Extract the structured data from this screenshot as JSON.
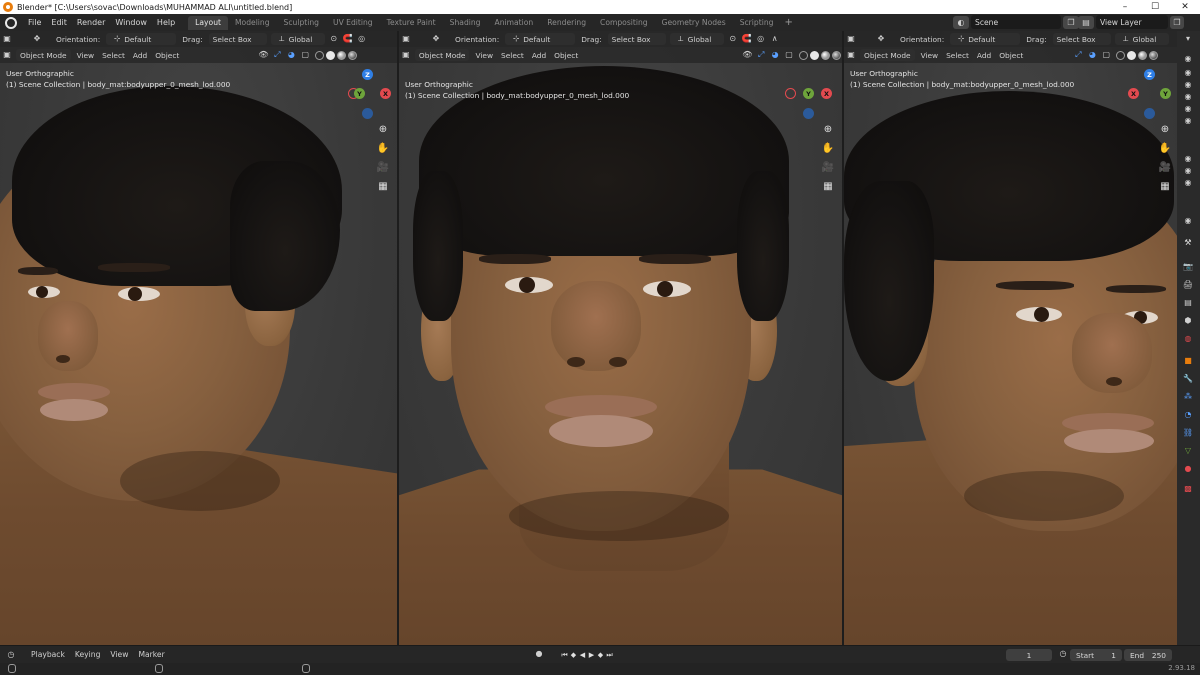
{
  "window": {
    "title": "Blender* [C:\\Users\\sovac\\Downloads\\MUHAMMAD ALI\\untitled.blend]",
    "controls": [
      "–",
      "☐",
      "✕"
    ]
  },
  "menubar": {
    "items": [
      "File",
      "Edit",
      "Render",
      "Window",
      "Help"
    ]
  },
  "workspaces": {
    "tabs": [
      "Layout",
      "Modeling",
      "Sculpting",
      "UV Editing",
      "Texture Paint",
      "Shading",
      "Animation",
      "Rendering",
      "Compositing",
      "Geometry Nodes",
      "Scripting"
    ],
    "active": "Layout",
    "add": "+"
  },
  "scene": {
    "scene_label": "Scene",
    "view_layer_label": "View Layer"
  },
  "viewport_header": {
    "orientation_label": "Orientation:",
    "orientation_value": "Default",
    "drag_label": "Drag:",
    "drag_value": "Select Box",
    "transform_value": "Global",
    "mode_label": "Object Mode",
    "menus": [
      "View",
      "Select",
      "Add",
      "Object"
    ]
  },
  "viewports": [
    {
      "view_name": "User Orthographic",
      "collection_info": "(1) Scene Collection | body_mat:bodyupper_0_mesh_lod.000"
    },
    {
      "view_name": "User Orthographic",
      "collection_info": "(1) Scene Collection | body_mat:bodyupper_0_mesh_lod.000"
    },
    {
      "view_name": "User Orthographic",
      "collection_info": "(1) Scene Collection | body_mat:bodyupper_0_mesh_lod.000"
    }
  ],
  "gizmo": {
    "z": "Z",
    "y": "Y",
    "x": "X"
  },
  "timeline": {
    "menus": [
      "Playback",
      "Keying",
      "View",
      "Marker"
    ],
    "current_frame": "1",
    "start_label": "Start",
    "start_value": "1",
    "end_label": "End",
    "end_value": "250"
  },
  "statusbar": {
    "version": "2.93.18"
  },
  "colors": {
    "accent": "#e87d0d",
    "axis_x": "#e34a4f",
    "axis_y": "#6ea43b",
    "axis_z": "#2f7fe6"
  }
}
